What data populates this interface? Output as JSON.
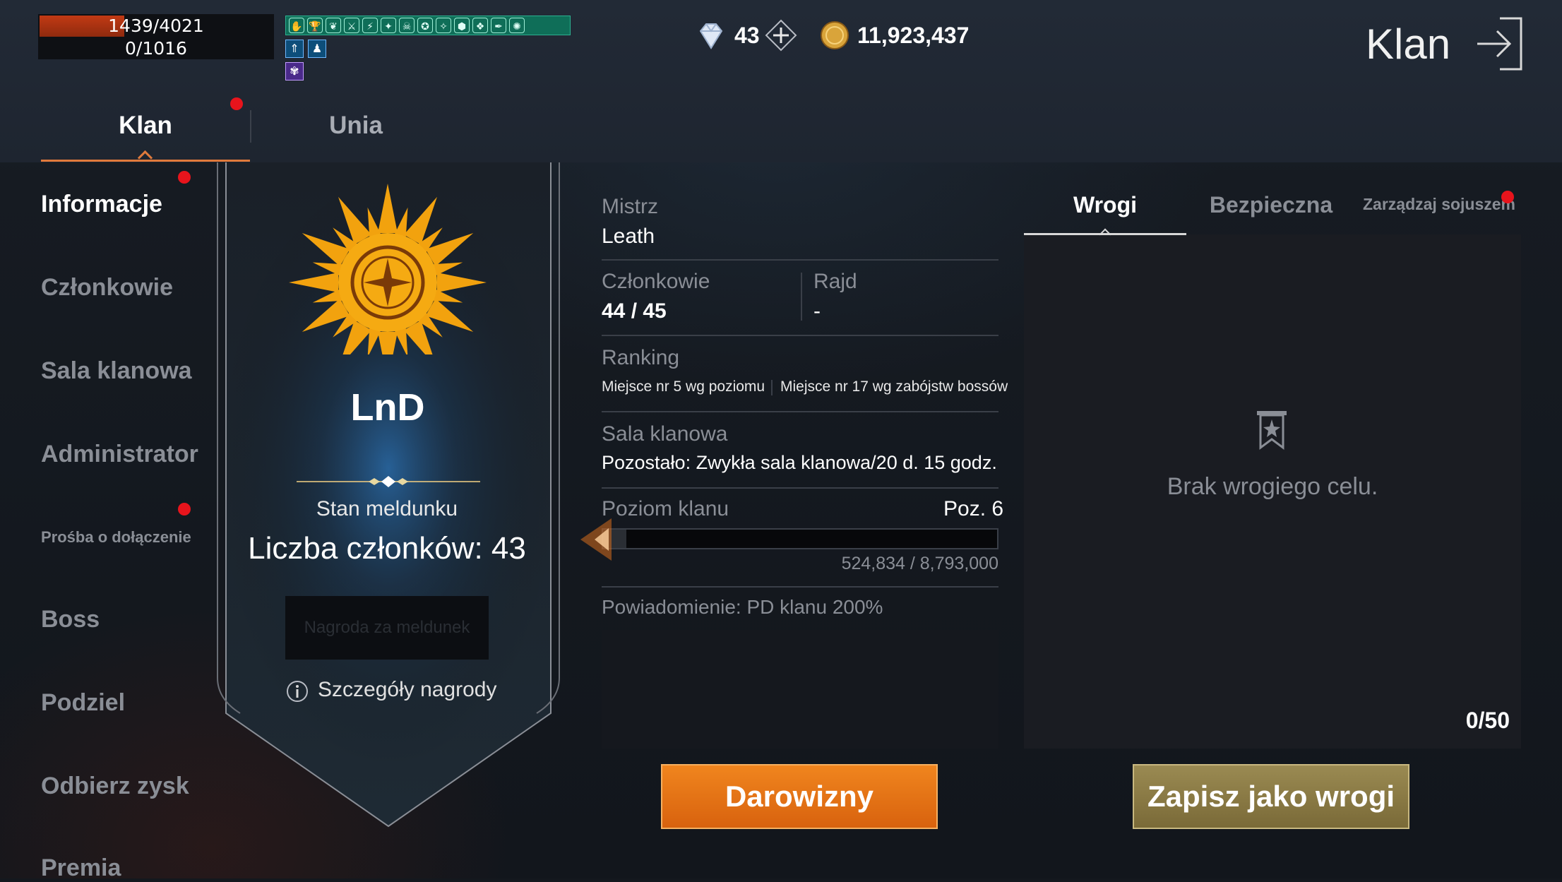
{
  "hud": {
    "hp": "1439/4021",
    "mp": "0/1016",
    "hp_fraction": 0.36,
    "buffs": [
      "✋",
      "🏆",
      "❦",
      "⚔",
      "⚡",
      "✦",
      "☠",
      "✪",
      "✧",
      "⬢",
      "❖",
      "✒",
      "✺"
    ],
    "buff_row2": [
      "⇑",
      "♟"
    ],
    "buff_row3": [
      "✾"
    ]
  },
  "currency": {
    "gems": "43",
    "gold": "11,923,437",
    "add_icon": "plus-icon",
    "gem_icon": "diamond-icon",
    "gold_icon": "coin-icon"
  },
  "header": {
    "title": "Klan",
    "exit_icon": "exit-arrow-icon"
  },
  "tabs": [
    {
      "label": "Klan",
      "active": true
    },
    {
      "label": "Unia",
      "active": false
    }
  ],
  "sidebar": {
    "items": [
      {
        "label": "Informacje",
        "active": true
      },
      {
        "label": "Członkowie"
      },
      {
        "label": "Sala klanowa"
      },
      {
        "label": "Administrator"
      },
      {
        "label": "Prośba o dołączenie"
      },
      {
        "label": "Boss"
      },
      {
        "label": "Podziel"
      },
      {
        "label": "Odbierz zysk"
      },
      {
        "label": "Premia"
      }
    ]
  },
  "clan": {
    "name": "LnD",
    "checkin_label": "Stan meldunku",
    "member_count_text": "Liczba członków: 43",
    "reward_button": "Nagroda za meldunek",
    "reward_details": "Szczegóły nagrody",
    "emblem_icon": "sun-emblem-icon",
    "info_icon": "info-icon"
  },
  "info": {
    "master_label": "Mistrz",
    "master_value": "Leath",
    "members_label": "Członkowie",
    "members_value": "44 / 45",
    "raid_label": "Rajd",
    "raid_value": "-",
    "ranking_label": "Ranking",
    "ranking_level": "Miejsce nr 5 wg poziomu",
    "ranking_boss": "Miejsce nr 17 wg zabójstw bossów",
    "hall_label": "Sala klanowa",
    "hall_value": "Pozostało: Zwykła sala klanowa/20 d. 15 godz.",
    "level_label": "Poziom klanu",
    "level_value": "Poz. 6",
    "xp_text": "524,834 / 8,793,000",
    "xp_fraction": 0.0597,
    "notice": "Powiadomienie: PD klanu 200%"
  },
  "enemies": {
    "tabs": [
      {
        "label": "Wrogi",
        "active": true
      },
      {
        "label": "Bezpieczna"
      },
      {
        "label": "Zarządzaj sojuszem"
      }
    ],
    "empty_text": "Brak wrogiego celu.",
    "count": "0/50",
    "empty_icon": "banner-icon"
  },
  "buttons": {
    "donate": "Darowizny",
    "save_enemy": "Zapisz jako wrogi"
  },
  "colors": {
    "accent_orange": "#e8731c",
    "notification_red": "#e8141c",
    "gold_button": "#8a7a4a",
    "hp_red": "#c23a14"
  }
}
